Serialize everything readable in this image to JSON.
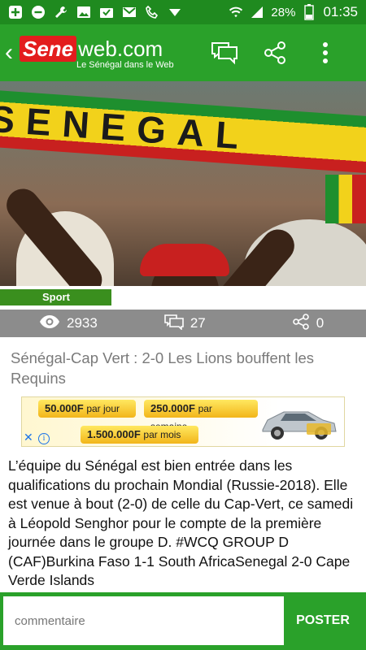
{
  "status_bar": {
    "battery": "28%",
    "time": "01:35",
    "icons": [
      "add-icon",
      "minus-icon",
      "wrench-icon",
      "photo-icon",
      "mail-check-icon",
      "gmail-icon",
      "phone-icon",
      "download-icon",
      "wifi-icon",
      "signal-icon",
      "battery-icon"
    ]
  },
  "app_bar": {
    "logo_brand": "Sene",
    "logo_suffix": "web.com",
    "tagline": "Le Sénégal dans le Web",
    "icons": [
      "back-icon",
      "comments-icon",
      "share-icon",
      "more-icon"
    ]
  },
  "article": {
    "category": "Sport",
    "views": "2933",
    "comments": "27",
    "shares": "0",
    "title": "Sénégal-Cap Vert : 2-0 Les Lions bouffent les Requins",
    "banner_text": "SENEGAL",
    "body": "L’équipe du Sénégal est bien entrée dans les qualifications du prochain Mondial (Russie-2018). Elle est venue à bout (2-0) de celle du Cap-Vert, ce samedi à Léopold Senghor pour le compte de la première journée dans le groupe D. #WCQ GROUP D (CAF)Burkina Faso 1-1 South AfricaSenegal 2-0 Cape Verde Islands"
  },
  "ad": {
    "offer1_amount": "50.000F",
    "offer1_period": "par jour",
    "offer2_amount": "250.000F",
    "offer2_period": "par semaine",
    "offer3_amount": "1.500.000F",
    "offer3_period": "par mois",
    "close": "✕",
    "info": "i"
  },
  "comment": {
    "placeholder": "commentaire",
    "submit": "POSTER"
  },
  "colors": {
    "primary_green": "#2aa12a",
    "status_green": "#1f8a1f",
    "logo_red": "#e31d1d",
    "stats_gray": "#8c8c8c"
  }
}
